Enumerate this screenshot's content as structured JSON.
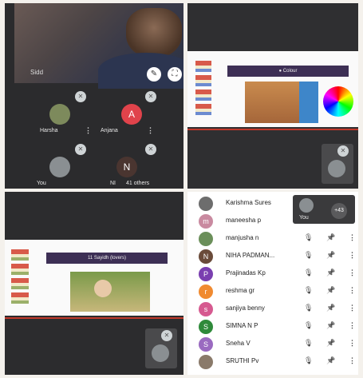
{
  "q1": {
    "self": {
      "name": "Sidd"
    },
    "tiles": [
      {
        "name": "Harsha",
        "avatar_letter": "",
        "color": "#7d8a5c"
      },
      {
        "name": "Anjana",
        "avatar_letter": "A",
        "color": "#e0434b"
      },
      {
        "name": "You",
        "avatar_letter": "",
        "color": "#8a8f92"
      },
      {
        "name": "NI",
        "avatar_letter": "N",
        "color": "#4a3530"
      }
    ],
    "others_label": "41 others"
  },
  "q2": {
    "slide_title": "● Colour"
  },
  "q3": {
    "slide_title": "11  Sayidh (lovers)"
  },
  "q4": {
    "mini_tiles": [
      {
        "name": "You"
      },
      {
        "name": "+43"
      }
    ],
    "participants": [
      {
        "name": "Karishma Sures",
        "initial": "",
        "color": "#6d6d6d"
      },
      {
        "name": "maneesha p",
        "initial": "m",
        "color": "#c98aa0"
      },
      {
        "name": "manjusha n",
        "initial": "",
        "color": "#6b8f5a"
      },
      {
        "name": "NIHA PADMAN...",
        "initial": "N",
        "color": "#6a4b3a"
      },
      {
        "name": "Prajinadas Kp",
        "initial": "P",
        "color": "#7a3fb0"
      },
      {
        "name": "reshma gr",
        "initial": "r",
        "color": "#f08a30"
      },
      {
        "name": "sanjiya benny",
        "initial": "s",
        "color": "#d65a90"
      },
      {
        "name": "SIMNA N P",
        "initial": "S",
        "color": "#2f8a3a"
      },
      {
        "name": "Sneha V",
        "initial": "S",
        "color": "#9a6ac0"
      },
      {
        "name": "SRUTHI Pv",
        "initial": "",
        "color": "#8a7a6a"
      }
    ]
  }
}
